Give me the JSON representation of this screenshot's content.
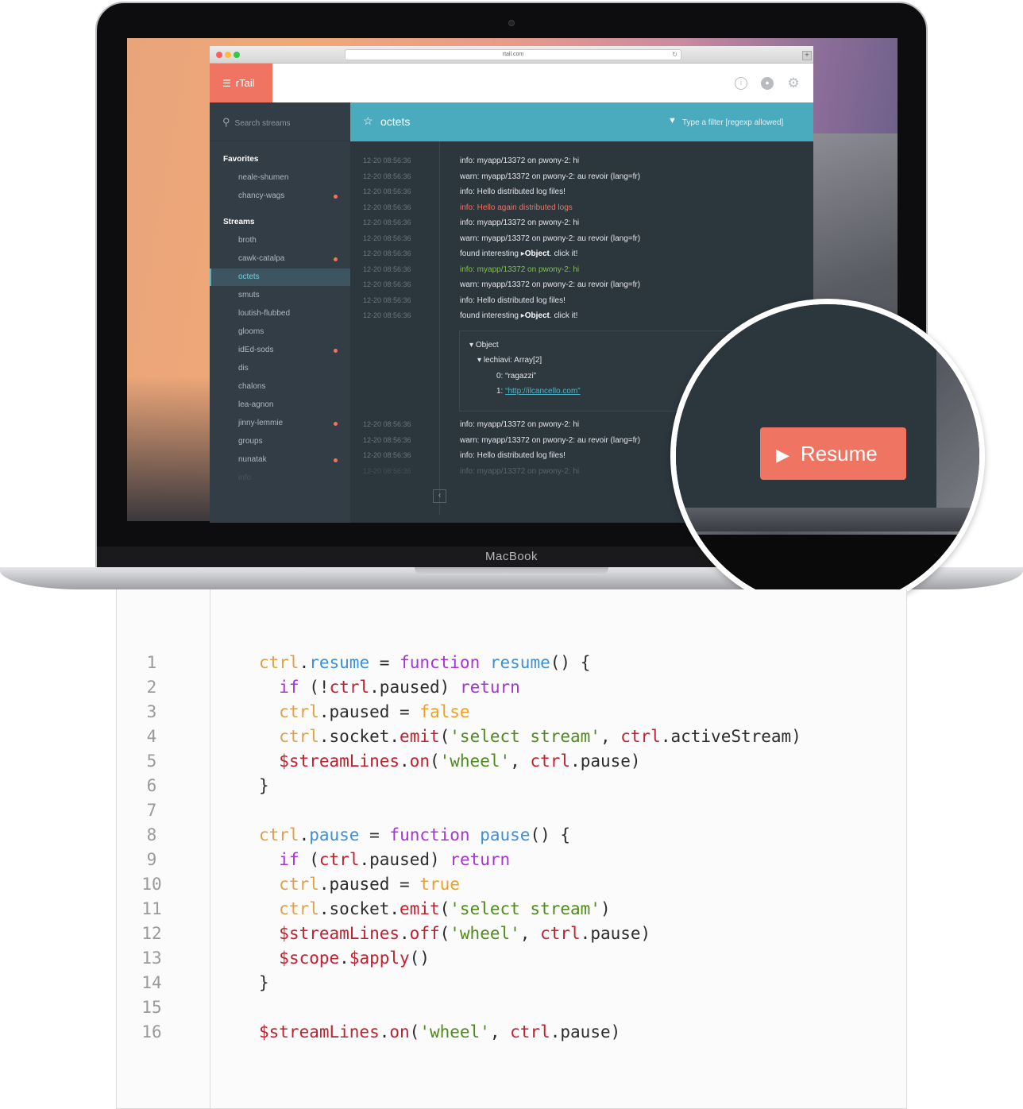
{
  "laptop": {
    "brand": "MacBook"
  },
  "browser": {
    "url": "rtail.com",
    "reload_icon": "reload-icon",
    "new_tab_label": "+"
  },
  "app": {
    "logo": "rTail",
    "menu_icon": "menu-icon",
    "header_icons": [
      "info-icon",
      "github-icon",
      "gear-icon"
    ]
  },
  "sidebar": {
    "search_placeholder": "Search streams",
    "favorites_title": "Favorites",
    "favorites": [
      {
        "name": "neale-shumen",
        "unread": false
      },
      {
        "name": "chancy-wags",
        "unread": true
      }
    ],
    "streams_title": "Streams",
    "streams": [
      {
        "name": "broth",
        "unread": false
      },
      {
        "name": "cawk-catalpa",
        "unread": true
      },
      {
        "name": "octets",
        "unread": false,
        "active": true
      },
      {
        "name": "smuts",
        "unread": false
      },
      {
        "name": "loutish-flubbed",
        "unread": false
      },
      {
        "name": "glooms",
        "unread": false
      },
      {
        "name": "idEd-sods",
        "unread": true
      },
      {
        "name": "dis",
        "unread": false
      },
      {
        "name": "chalons",
        "unread": false
      },
      {
        "name": "lea-agnon",
        "unread": false
      },
      {
        "name": "jinny-lemmie",
        "unread": true
      },
      {
        "name": "groups",
        "unread": false
      },
      {
        "name": "nunatak",
        "unread": true
      },
      {
        "name": "info",
        "unread": false
      }
    ]
  },
  "stream_header": {
    "title": "octets",
    "filter_placeholder": "Type a filter [regexp allowed]"
  },
  "logs": [
    {
      "time": "12-20  08:56:36",
      "text": "info: myapp/13372 on pwony-2: hi",
      "style": "normal"
    },
    {
      "time": "12-20  08:56:36",
      "text": "warn: myapp/13372 on pwony-2: au revoir (lang=fr)",
      "style": "normal"
    },
    {
      "time": "12-20  08:56:36",
      "text": "info: Hello distributed log files!",
      "style": "normal"
    },
    {
      "time": "12-20  08:56:36",
      "text": "info: Hello again distributed logs",
      "style": "error"
    },
    {
      "time": "12-20  08:56:36",
      "text": "info: myapp/13372 on pwony-2: hi",
      "style": "normal"
    },
    {
      "time": "12-20  08:56:36",
      "text": "warn: myapp/13372 on pwony-2: au revoir (lang=fr)",
      "style": "normal"
    },
    {
      "time": "12-20  08:56:36",
      "text": "found interesting",
      "object": "Object",
      "suffix": ". click it!",
      "style": "normal"
    },
    {
      "time": "12-20  08:56:36",
      "text": "info: myapp/13372 on pwony-2: hi",
      "style": "success"
    },
    {
      "time": "12-20  08:56:36",
      "text": "warn: myapp/13372 on pwony-2: au revoir (lang=fr)",
      "style": "normal"
    },
    {
      "time": "12-20  08:56:36",
      "text": "info: Hello distributed log files!",
      "style": "normal"
    },
    {
      "time": "12-20  08:56:36",
      "text": "found interesting",
      "object": "Object",
      "suffix": ". click it!",
      "style": "normal"
    }
  ],
  "object_tree": {
    "root": "Object",
    "key": "lechiavi: Array[2]",
    "item0": "0: “ragazzi”",
    "item1_label": "1: ",
    "item1_link": "“http://ilcancello.com”"
  },
  "logs_after": [
    {
      "time": "12-20  08:56:36",
      "text": "info: myapp/13372 on pwony-2: hi",
      "style": "normal"
    },
    {
      "time": "12-20  08:56:36",
      "text": "warn: myapp/13372 on pwony-2: au revoir (lang=fr)",
      "style": "normal"
    },
    {
      "time": "12-20  08:56:36",
      "text": "info: Hello distributed log files!",
      "style": "normal"
    },
    {
      "time": "12-20  08:56:36",
      "text": "info: myapp/13372 on pwony-2: hi",
      "style": "faded"
    }
  ],
  "collapse_label": "‹",
  "resume_button": {
    "label": "Resume",
    "icon": "play-icon"
  },
  "code": {
    "line_numbers": [
      "1",
      "2",
      "3",
      "4",
      "5",
      "6",
      "7",
      "8",
      "9",
      "10",
      "11",
      "12",
      "13",
      "14",
      "15",
      "16"
    ],
    "lines": [
      "ctrl.resume = function resume() {",
      "  if (!ctrl.paused) return",
      "  ctrl.paused = false",
      "  ctrl.socket.emit('select stream', ctrl.activeStream)",
      "  $streamLines.on('wheel', ctrl.pause)",
      "}",
      "",
      "ctrl.pause = function pause() {",
      "  if (ctrl.paused) return",
      "  ctrl.paused = true",
      "  ctrl.socket.emit('select stream')",
      "  $streamLines.off('wheel', ctrl.pause)",
      "  $scope.$apply()",
      "}",
      "",
      "$streamLines.on('wheel', ctrl.pause)"
    ]
  }
}
